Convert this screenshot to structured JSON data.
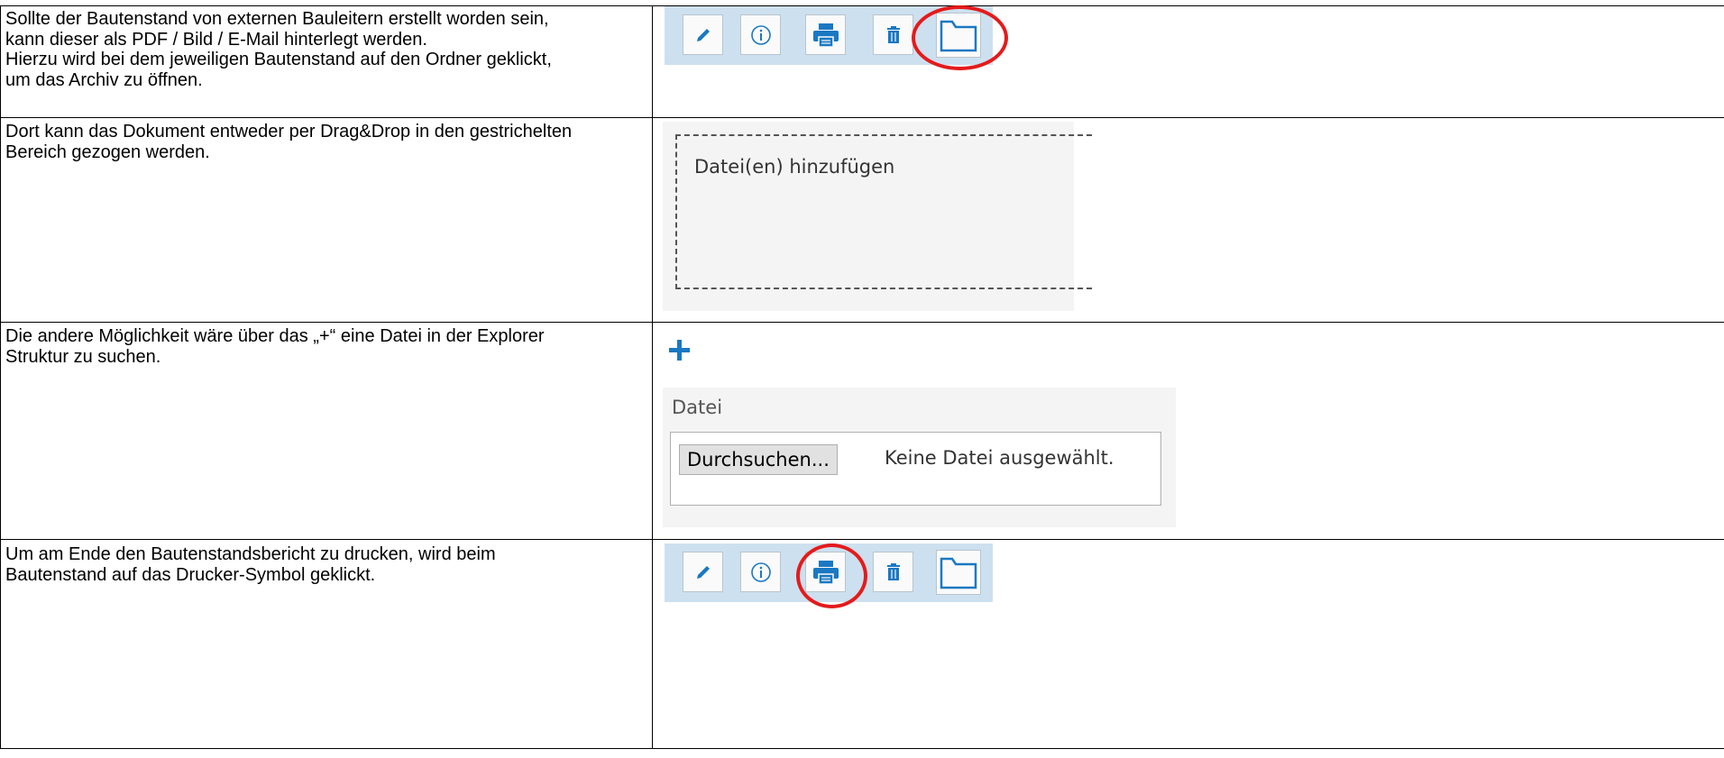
{
  "rows": [
    {
      "text": "Sollte der Bautenstand von externen Bauleitern erstellt worden sein,\nkann dieser als PDF / Bild / E-Mail hinterlegt werden.\nHierzu wird bei dem jeweiligen Bautenstand auf den Ordner geklickt,\num das Archiv zu öffnen."
    },
    {
      "text": "Dort kann das Dokument entweder per Drag&Drop in den gestrichelten\nBereich gezogen werden."
    },
    {
      "text": "Die andere Möglichkeit wäre über das „+“ eine Datei in der Explorer\nStruktur zu suchen."
    },
    {
      "text": "Um am Ende den Bautenstandsbericht zu drucken, wird beim\nBautenstand auf das Drucker-Symbol geklickt."
    }
  ],
  "toolbar_icons": [
    "pencil-icon",
    "info-icon",
    "printer-icon",
    "trash-icon",
    "folder-icon"
  ],
  "dropzone": {
    "label": "Datei(en) hinzufügen"
  },
  "file_picker": {
    "label": "Datei",
    "browse_label": "Durchsuchen...",
    "status": "Keine Datei ausgewählt."
  },
  "colors": {
    "accent": "#1a78c2",
    "highlight": "#e41b1b",
    "toolbar_bg": "#cde0ef"
  }
}
